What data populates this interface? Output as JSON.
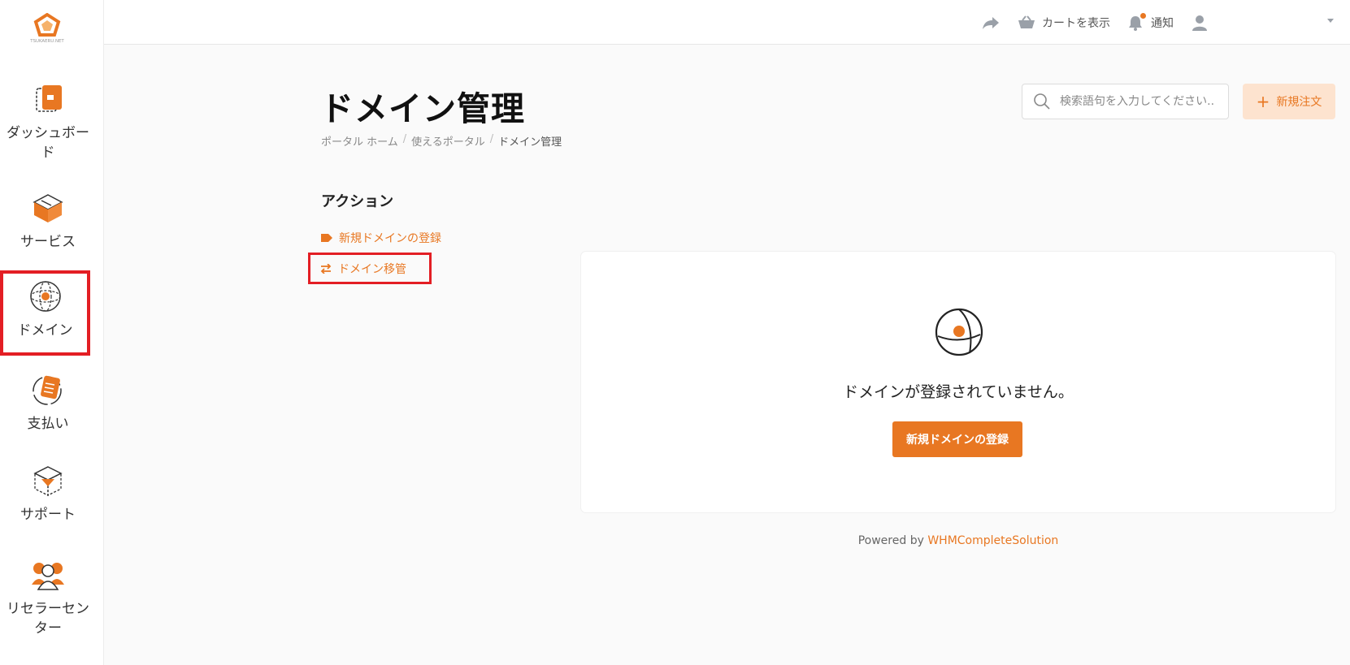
{
  "brand": {
    "accent": "#e87722",
    "highlight": "#e31e24",
    "logo_text": "TSUKAERU.NET"
  },
  "sidebar": {
    "items": [
      {
        "label": "ダッシュボード",
        "icon": "dashboard-icon"
      },
      {
        "label": "サービス",
        "icon": "services-box-icon"
      },
      {
        "label": "ドメイン",
        "icon": "globe-icon"
      },
      {
        "label": "支払い",
        "icon": "billing-icon"
      },
      {
        "label": "サポート",
        "icon": "support-box-icon"
      },
      {
        "label": "リセラーセンター",
        "icon": "reseller-users-icon"
      }
    ]
  },
  "topbar": {
    "cart_label": "カートを表示",
    "notifications_label": "通知"
  },
  "page": {
    "title": "ドメイン管理",
    "breadcrumb": [
      "ポータル ホーム",
      "使えるポータル",
      "ドメイン管理"
    ]
  },
  "search": {
    "placeholder": "検索語句を入力してください.."
  },
  "new_order": {
    "label": "新規注文"
  },
  "actions": {
    "heading": "アクション",
    "register_domain": "新規ドメインの登録",
    "transfer_domain": "ドメイン移管"
  },
  "empty_state": {
    "message": "ドメインが登録されていません。",
    "button_label": "新規ドメインの登録"
  },
  "footer": {
    "powered_by": "Powered by",
    "link_text": "WHMCompleteSolution"
  }
}
